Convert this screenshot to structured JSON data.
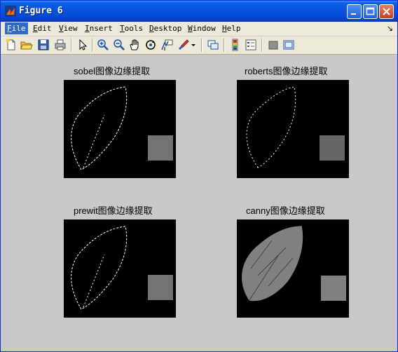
{
  "window": {
    "title": "Figure 6"
  },
  "menu": [
    "File",
    "Edit",
    "View",
    "Insert",
    "Tools",
    "Desktop",
    "Window",
    "Help"
  ],
  "menu_accels": [
    "F",
    "E",
    "V",
    "I",
    "T",
    "D",
    "W",
    "H"
  ],
  "toolbar_icons": [
    "new-figure-icon",
    "open-file-icon",
    "save-icon",
    "print-icon",
    "pointer-icon",
    "zoom-in-icon",
    "zoom-out-icon",
    "pan-hand-icon",
    "rotate-3d-icon",
    "data-cursor-icon",
    "brush-icon",
    "brush-dropdown-icon",
    "link-plot-icon",
    "colorbar-icon",
    "legend-icon",
    "hide-plot-tools-icon",
    "show-plot-tools-icon"
  ],
  "panels": [
    {
      "title": "sobel图像边缘提取",
      "method": "sobel"
    },
    {
      "title": "roberts图像边缘提取",
      "method": "roberts"
    },
    {
      "title": "prewit图像边缘提取",
      "method": "prewit"
    },
    {
      "title": "canny图像边缘提取",
      "method": "canny"
    }
  ]
}
